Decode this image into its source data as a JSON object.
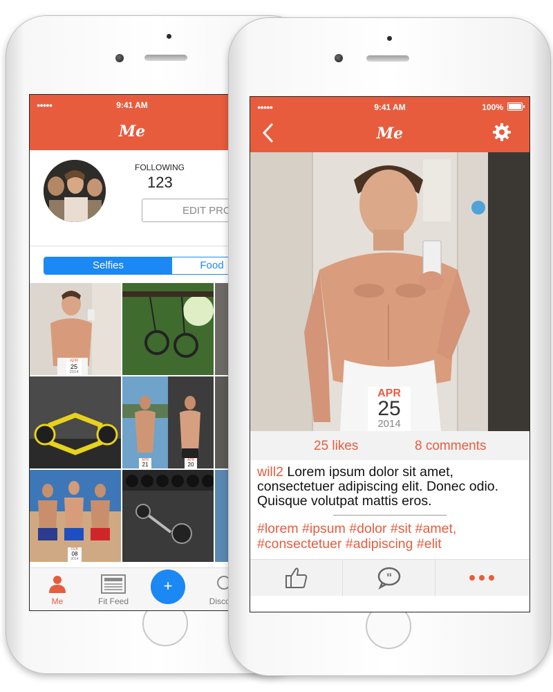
{
  "colors": {
    "accent": "#e85c3e",
    "blue": "#1b88f4"
  },
  "status": {
    "signal": "●●●●●",
    "time": "9:41 AM",
    "battery": "100%"
  },
  "profile": {
    "title": "Me",
    "following_label": "FOLLOWING",
    "following_count": "123",
    "edit_button": "EDIT PROFILE",
    "segments": [
      "Selfies",
      "Food"
    ],
    "grid_dates": [
      {
        "month": "APR",
        "day": "25",
        "year": "2014"
      },
      {
        "month": "APR",
        "day": "21",
        "year": ""
      },
      {
        "month": "APR",
        "day": "20",
        "year": ""
      },
      {
        "month": "FEB",
        "day": "08",
        "year": "2014"
      }
    ],
    "tabs": [
      {
        "label": "Me",
        "icon": "person-icon"
      },
      {
        "label": "Fit Feed",
        "icon": "newspaper-icon"
      },
      {
        "label": "+",
        "icon": "plus-icon"
      },
      {
        "label": "Discover",
        "icon": "search-icon"
      }
    ]
  },
  "post": {
    "title": "Me",
    "back_icon": "chevron-left-icon",
    "settings_icon": "gear-icon",
    "date": {
      "month": "APR",
      "day": "25",
      "year": "2014"
    },
    "likes": "25 likes",
    "comments": "8 comments",
    "username": "will2",
    "caption": " Lorem ipsum dolor sit amet, consectetuer adipiscing elit. Donec odio. Quisque volutpat mattis eros.",
    "hashtags": "#lorem #ipsum #dolor #sit #amet, #consectetuer #adipiscing #elit",
    "actions": [
      "thumbs-up-icon",
      "comment-icon",
      "more-icon"
    ]
  }
}
